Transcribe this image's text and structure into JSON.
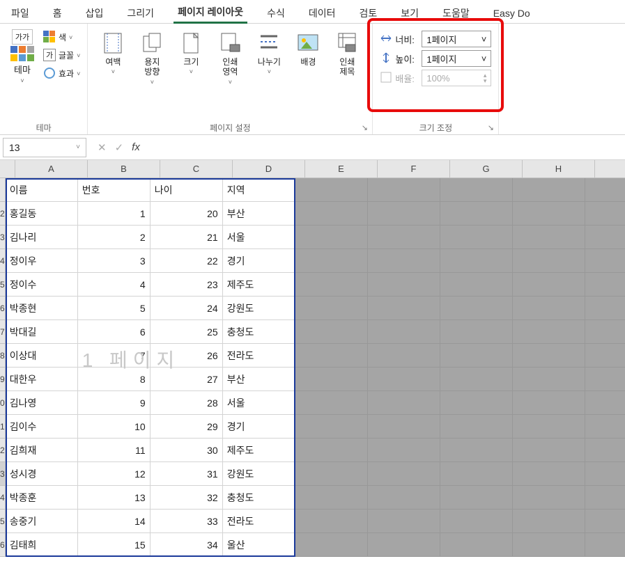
{
  "tabs": {
    "file": "파일",
    "home": "홈",
    "insert": "삽입",
    "draw": "그리기",
    "pagelayout": "페이지 레이아웃",
    "formulas": "수식",
    "data": "데이터",
    "review": "검토",
    "view": "보기",
    "help": "도움말",
    "easydo": "Easy Do"
  },
  "ribbon": {
    "themes": {
      "group_label": "테마",
      "themes_btn": "테마",
      "aa_sample": "가가",
      "colors": "색",
      "fonts": "글꼴",
      "effects": "효과",
      "font_sample": "가"
    },
    "pagesetup": {
      "group_label": "페이지 설정",
      "margins": "여백",
      "orientation": "용지\n방향",
      "size": "크기",
      "printarea": "인쇄\n영역",
      "breaks": "나누기",
      "background": "배경",
      "printtitles": "인쇄\n제목"
    },
    "scale": {
      "group_label": "크기 조정",
      "width_label": "너비:",
      "height_label": "높이:",
      "scale_label": "배율:",
      "width_value": "1페이지",
      "height_value": "1페이지",
      "scale_value": "100%"
    }
  },
  "formula_bar": {
    "namebox": "13",
    "fx": "fx"
  },
  "columns": [
    "A",
    "B",
    "C",
    "D",
    "E",
    "F",
    "G",
    "H"
  ],
  "row_numbers": [
    "",
    "2",
    "3",
    "4",
    "5",
    "6",
    "7",
    "8",
    "9",
    "0",
    "1",
    "2",
    "3",
    "4",
    "5",
    "6"
  ],
  "grid": {
    "header": {
      "a": "이름",
      "b": "번호",
      "c": "나이",
      "d": "지역"
    },
    "rows": [
      {
        "a": "홍길동",
        "b": "1",
        "c": "20",
        "d": "부산"
      },
      {
        "a": "김나리",
        "b": "2",
        "c": "21",
        "d": "서울"
      },
      {
        "a": "정이우",
        "b": "3",
        "c": "22",
        "d": "경기"
      },
      {
        "a": "정이수",
        "b": "4",
        "c": "23",
        "d": "제주도"
      },
      {
        "a": "박종현",
        "b": "5",
        "c": "24",
        "d": "강원도"
      },
      {
        "a": "박대길",
        "b": "6",
        "c": "25",
        "d": "충청도"
      },
      {
        "a": "이상대",
        "b": "7",
        "c": "26",
        "d": "전라도"
      },
      {
        "a": "대한우",
        "b": "8",
        "c": "27",
        "d": "부산"
      },
      {
        "a": "김나영",
        "b": "9",
        "c": "28",
        "d": "서울"
      },
      {
        "a": "김이수",
        "b": "10",
        "c": "29",
        "d": "경기"
      },
      {
        "a": "김희재",
        "b": "11",
        "c": "30",
        "d": "제주도"
      },
      {
        "a": "성시경",
        "b": "12",
        "c": "31",
        "d": "강원도"
      },
      {
        "a": "박종훈",
        "b": "13",
        "c": "32",
        "d": "충청도"
      },
      {
        "a": "송중기",
        "b": "14",
        "c": "33",
        "d": "전라도"
      },
      {
        "a": "김태희",
        "b": "15",
        "c": "34",
        "d": "울산"
      }
    ]
  },
  "watermark": "1 페이지",
  "icons": {
    "dropdown": "▾",
    "dd_small": "˅",
    "launcher": "↘"
  }
}
